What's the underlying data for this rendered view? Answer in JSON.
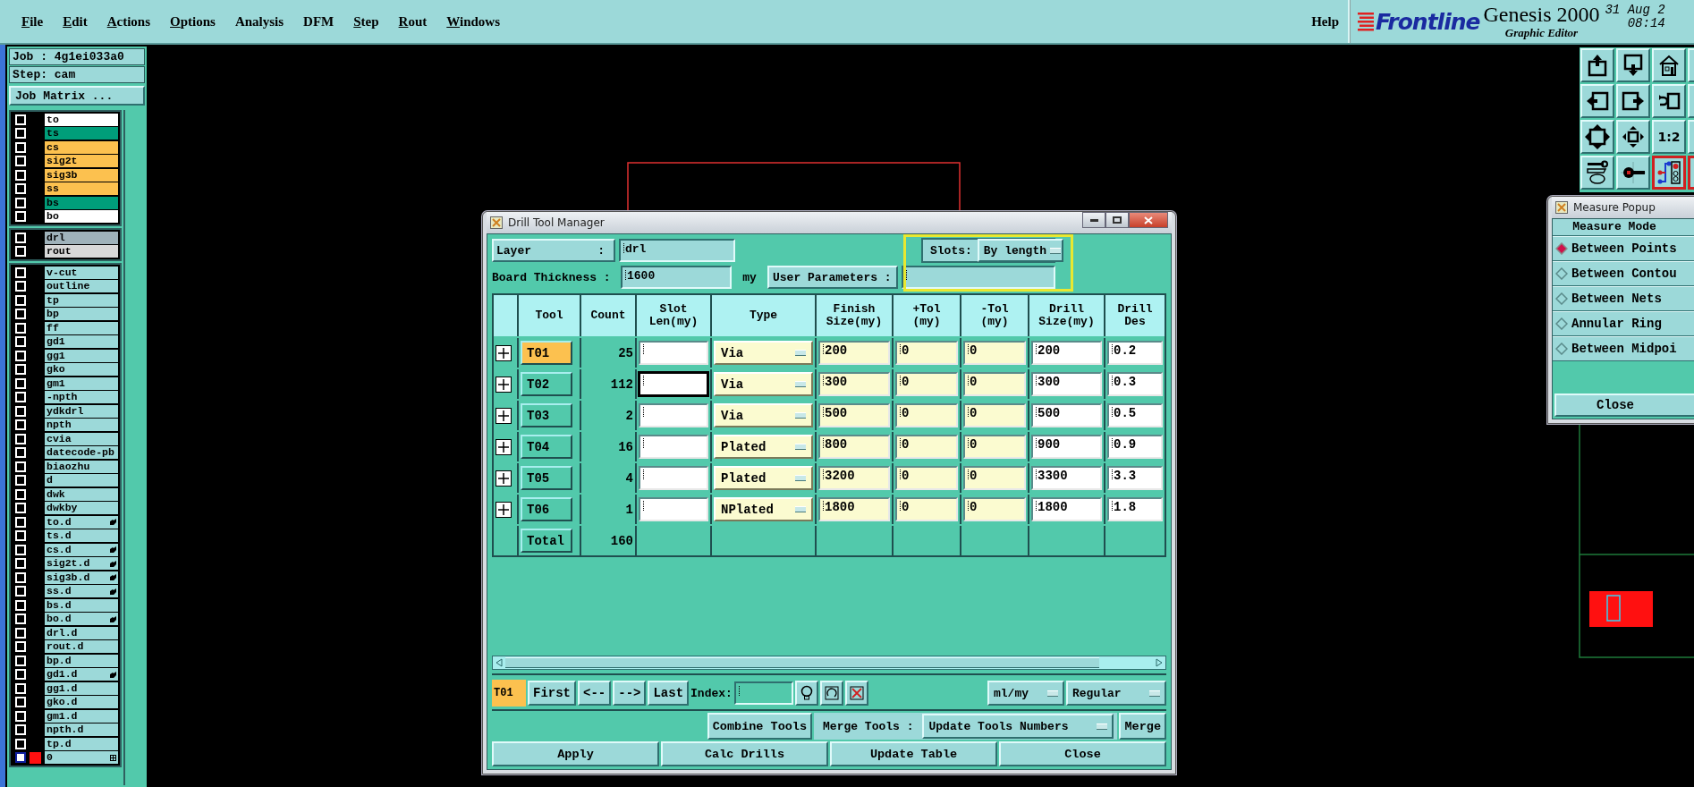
{
  "menu_bar": {
    "items": [
      {
        "label": "File",
        "mnemonic": true
      },
      {
        "label": "Edit",
        "mnemonic": true
      },
      {
        "label": "Actions",
        "mnemonic": true
      },
      {
        "label": "Options",
        "mnemonic": true
      },
      {
        "label": "Analysis",
        "mnemonic": false
      },
      {
        "label": "DFM",
        "mnemonic": false
      },
      {
        "label": "Step",
        "mnemonic": true
      },
      {
        "label": "Rout",
        "mnemonic": true
      },
      {
        "label": "Windows",
        "mnemonic": true
      }
    ],
    "help": "Help"
  },
  "branding": {
    "logo": "Frontline",
    "product": "Genesis 2000",
    "subtitle": "Graphic Editor",
    "date": "31 Aug 2",
    "time": "08:14"
  },
  "job_panel": {
    "job": "Job : 4g1ei033a0",
    "step": "Step: cam",
    "matrix_button": "Job Matrix ...",
    "layer_groups": [
      [
        {
          "name": "to",
          "color": "#ffffff",
          "flagged": false,
          "checked": false,
          "kind": "layer"
        },
        {
          "name": "ts",
          "color": "#009e7a",
          "flagged": false,
          "checked": false,
          "kind": "layer"
        },
        {
          "name": "cs",
          "color": "#fcc14f",
          "flagged": false,
          "checked": false,
          "kind": "layer"
        },
        {
          "name": "sig2t",
          "color": "#fcc14f",
          "flagged": false,
          "checked": false,
          "kind": "layer"
        },
        {
          "name": "sig3b",
          "color": "#fcc14f",
          "flagged": false,
          "checked": false,
          "kind": "layer"
        },
        {
          "name": "ss",
          "color": "#fcc14f",
          "flagged": false,
          "checked": false,
          "kind": "layer"
        },
        {
          "name": "bs",
          "color": "#009e7a",
          "flagged": false,
          "checked": false,
          "kind": "layer"
        },
        {
          "name": "bo",
          "color": "#ffffff",
          "flagged": false,
          "checked": false,
          "kind": "layer"
        }
      ],
      [
        {
          "name": "drl",
          "color": "#9fb2ba",
          "flagged": false,
          "checked": false,
          "kind": "layer"
        },
        {
          "name": "rout",
          "color": "#d8d8d8",
          "flagged": false,
          "checked": false,
          "kind": "layer"
        }
      ],
      [
        {
          "name": "v-cut",
          "color": "#9cd9d9",
          "flagged": false,
          "checked": false,
          "kind": "layer"
        },
        {
          "name": "outline",
          "color": "#9cd9d9",
          "flagged": false,
          "checked": false,
          "kind": "layer"
        },
        {
          "name": "tp",
          "color": "#9cd9d9",
          "flagged": false,
          "checked": false,
          "kind": "layer"
        },
        {
          "name": "bp",
          "color": "#9cd9d9",
          "flagged": false,
          "checked": false,
          "kind": "layer"
        },
        {
          "name": "ff",
          "color": "#9cd9d9",
          "flagged": false,
          "checked": false,
          "kind": "layer"
        },
        {
          "name": "gd1",
          "color": "#9cd9d9",
          "flagged": false,
          "checked": false,
          "kind": "layer"
        },
        {
          "name": "gg1",
          "color": "#9cd9d9",
          "flagged": false,
          "checked": false,
          "kind": "layer"
        },
        {
          "name": "gko",
          "color": "#9cd9d9",
          "flagged": false,
          "checked": false,
          "kind": "layer"
        },
        {
          "name": "gm1",
          "color": "#9cd9d9",
          "flagged": false,
          "checked": false,
          "kind": "layer"
        },
        {
          "name": "-npth",
          "color": "#9cd9d9",
          "flagged": false,
          "checked": false,
          "kind": "layer"
        },
        {
          "name": "ydkdrl",
          "color": "#9cd9d9",
          "flagged": false,
          "checked": false,
          "kind": "layer"
        },
        {
          "name": "npth",
          "color": "#9cd9d9",
          "flagged": false,
          "checked": false,
          "kind": "layer"
        },
        {
          "name": "cvia",
          "color": "#9cd9d9",
          "flagged": false,
          "checked": false,
          "kind": "layer"
        },
        {
          "name": "datecode-pb",
          "color": "#9cd9d9",
          "flagged": false,
          "checked": false,
          "kind": "layer"
        },
        {
          "name": "biaozhu",
          "color": "#9cd9d9",
          "flagged": false,
          "checked": false,
          "kind": "layer"
        },
        {
          "name": "d",
          "color": "#9cd9d9",
          "flagged": false,
          "checked": false,
          "kind": "layer"
        },
        {
          "name": "dwk",
          "color": "#9cd9d9",
          "flagged": false,
          "checked": false,
          "kind": "layer"
        },
        {
          "name": "dwkby",
          "color": "#9cd9d9",
          "flagged": false,
          "checked": false,
          "kind": "layer"
        },
        {
          "name": "to.d",
          "color": "#9cd9d9",
          "flagged": true,
          "checked": false,
          "kind": "layer"
        },
        {
          "name": "ts.d",
          "color": "#9cd9d9",
          "flagged": false,
          "checked": false,
          "kind": "layer"
        },
        {
          "name": "cs.d",
          "color": "#9cd9d9",
          "flagged": true,
          "checked": false,
          "kind": "layer"
        },
        {
          "name": "sig2t.d",
          "color": "#9cd9d9",
          "flagged": true,
          "checked": false,
          "kind": "layer"
        },
        {
          "name": "sig3b.d",
          "color": "#9cd9d9",
          "flagged": true,
          "checked": false,
          "kind": "layer"
        },
        {
          "name": "ss.d",
          "color": "#9cd9d9",
          "flagged": true,
          "checked": false,
          "kind": "layer"
        },
        {
          "name": "bs.d",
          "color": "#9cd9d9",
          "flagged": false,
          "checked": false,
          "kind": "layer"
        },
        {
          "name": "bo.d",
          "color": "#9cd9d9",
          "flagged": true,
          "checked": false,
          "kind": "layer"
        },
        {
          "name": "drl.d",
          "color": "#9cd9d9",
          "flagged": false,
          "checked": false,
          "kind": "layer"
        },
        {
          "name": "rout.d",
          "color": "#9cd9d9",
          "flagged": false,
          "checked": false,
          "kind": "layer"
        },
        {
          "name": "bp.d",
          "color": "#9cd9d9",
          "flagged": false,
          "checked": false,
          "kind": "layer"
        },
        {
          "name": "gd1.d",
          "color": "#9cd9d9",
          "flagged": true,
          "checked": false,
          "kind": "layer"
        },
        {
          "name": "gg1.d",
          "color": "#9cd9d9",
          "flagged": false,
          "checked": false,
          "kind": "layer"
        },
        {
          "name": "gko.d",
          "color": "#9cd9d9",
          "flagged": false,
          "checked": false,
          "kind": "layer"
        },
        {
          "name": "gm1.d",
          "color": "#9cd9d9",
          "flagged": false,
          "checked": false,
          "kind": "layer"
        },
        {
          "name": "npth.d",
          "color": "#9cd9d9",
          "flagged": false,
          "checked": false,
          "kind": "layer"
        },
        {
          "name": "tp.d",
          "color": "#9cd9d9",
          "flagged": false,
          "checked": false,
          "kind": "layer"
        },
        {
          "name": "0",
          "color": "#9cd9d9",
          "flagged": false,
          "checked": false,
          "kind": "work"
        }
      ]
    ]
  },
  "toolbar": [
    {
      "kind": "up",
      "highlighted": false
    },
    {
      "kind": "down",
      "highlighted": false
    },
    {
      "kind": "home",
      "highlighted": false
    },
    {
      "kind": "blank",
      "highlighted": false
    },
    {
      "kind": "left",
      "highlighted": false
    },
    {
      "kind": "right",
      "highlighted": false
    },
    {
      "kind": "undo",
      "highlighted": false
    },
    {
      "kind": "blank",
      "highlighted": false
    },
    {
      "kind": "fit",
      "highlighted": false
    },
    {
      "kind": "center",
      "highlighted": false
    },
    {
      "kind": "text",
      "label": "1:2",
      "highlighted": false
    },
    {
      "kind": "blank",
      "highlighted": false
    },
    {
      "kind": "tools",
      "highlighted": false
    },
    {
      "kind": "probe",
      "highlighted": false
    },
    {
      "kind": "circuit",
      "highlighted": true
    },
    {
      "kind": "blank",
      "highlighted": true
    }
  ],
  "drill_tool_manager": {
    "title": "Drill Tool Manager",
    "layer_label": "Layer",
    "layer_colon": ":",
    "layer_value": "drl",
    "slots_label": "Slots:",
    "slots_value": "By length",
    "thickness_label": "Board Thickness :",
    "thickness_value": "1600",
    "thickness_unit": "my",
    "user_params_label": "User Parameters :",
    "columns": [
      "Tool",
      "Count",
      "Slot Len(my)",
      "Type",
      "Finish Size(my)",
      "+Tol (my)",
      "-Tol (my)",
      "Drill Size(my)",
      "Drill Des"
    ],
    "rows": [
      {
        "tool": "T01",
        "selected": true,
        "count": "25",
        "slot_focused": false,
        "type": "Via",
        "finish": "200",
        "plus_tol": "0",
        "minus_tol": "0",
        "drill_size": "200",
        "drill_des": "0.2"
      },
      {
        "tool": "T02",
        "selected": false,
        "count": "112",
        "slot_focused": true,
        "type": "Via",
        "finish": "300",
        "plus_tol": "0",
        "minus_tol": "0",
        "drill_size": "300",
        "drill_des": "0.3"
      },
      {
        "tool": "T03",
        "selected": false,
        "count": "2",
        "slot_focused": false,
        "type": "Via",
        "finish": "500",
        "plus_tol": "0",
        "minus_tol": "0",
        "drill_size": "500",
        "drill_des": "0.5"
      },
      {
        "tool": "T04",
        "selected": false,
        "count": "16",
        "slot_focused": false,
        "type": "Plated",
        "finish": "800",
        "plus_tol": "0",
        "minus_tol": "0",
        "drill_size": "900",
        "drill_des": "0.9"
      },
      {
        "tool": "T05",
        "selected": false,
        "count": "4",
        "slot_focused": false,
        "type": "Plated",
        "finish": "3200",
        "plus_tol": "0",
        "minus_tol": "0",
        "drill_size": "3300",
        "drill_des": "3.3"
      },
      {
        "tool": "T06",
        "selected": false,
        "count": "1",
        "slot_focused": false,
        "type": "NPlated",
        "finish": "1800",
        "plus_tol": "0",
        "minus_tol": "0",
        "drill_size": "1800",
        "drill_des": "1.8"
      }
    ],
    "total_label": "Total",
    "total_count": "160",
    "nav": {
      "current": "T01",
      "first": "First",
      "prev": "<--",
      "next": "-->",
      "last": "Last",
      "index_label": "Index:",
      "units": "ml/my",
      "mode": "Regular"
    },
    "merge": {
      "combine": "Combine Tools",
      "label": "Merge Tools :",
      "option": "Update Tools Numbers",
      "merge": "Merge"
    },
    "actions": [
      "Apply",
      "Calc Drills",
      "Update Table",
      "Close"
    ]
  },
  "measure_popup": {
    "title": "Measure Popup",
    "heading": "Measure Mode",
    "modes": [
      {
        "label": "Between Points",
        "selected": true
      },
      {
        "label": "Between Contou",
        "selected": false
      },
      {
        "label": "Between Nets",
        "selected": false
      },
      {
        "label": "Annular Ring",
        "selected": false
      },
      {
        "label": "Between Midpoi",
        "selected": false
      }
    ],
    "close": "Close"
  }
}
